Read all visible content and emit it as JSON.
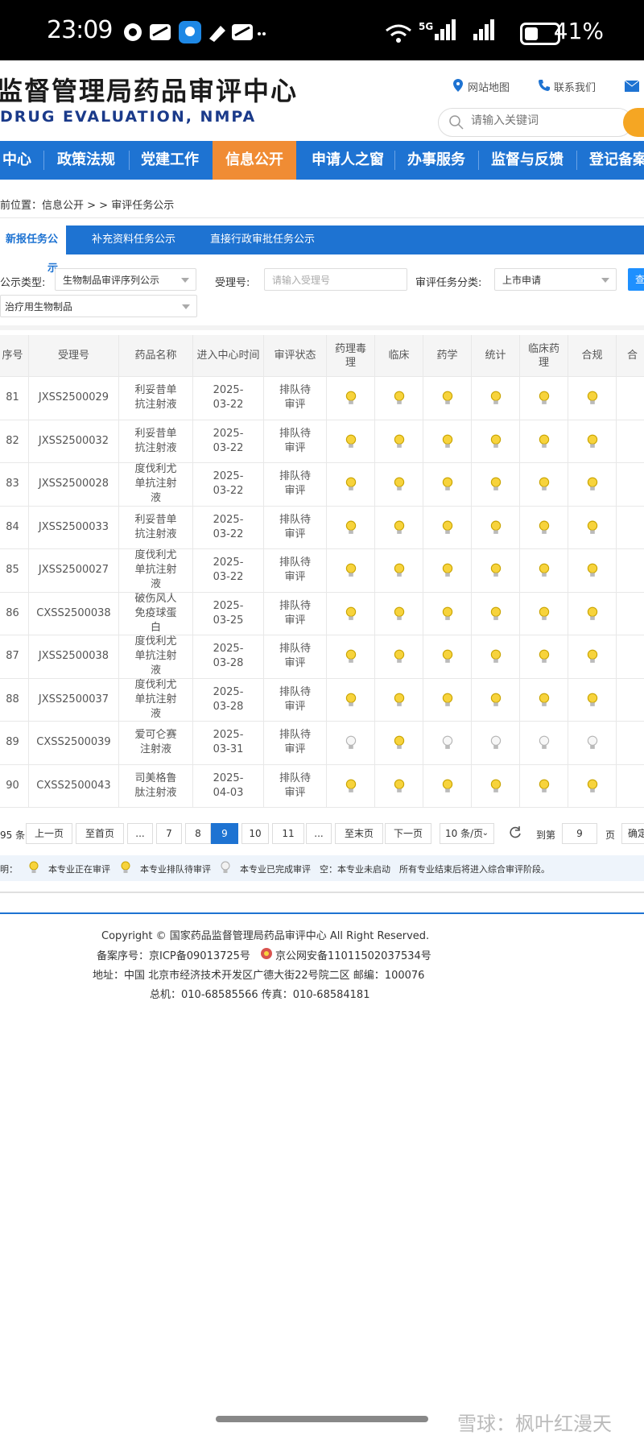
{
  "status_bar": {
    "time": "23:09",
    "network": "5G",
    "battery": "41%",
    "battery_level": 0.41
  },
  "header": {
    "title": "监督管理局药品审评中心",
    "subtitle": "DRUG EVALUATION, NMPA",
    "links": [
      "网站地图",
      "联系我们"
    ],
    "search_placeholder": "请输入关键词"
  },
  "nav": {
    "items": [
      "中心",
      "政策法规",
      "党建工作",
      "信息公开",
      "申请人之窗",
      "办事服务",
      "监督与反馈",
      "登记备案"
    ],
    "active": "信息公开"
  },
  "breadcrumb": {
    "label": "前位置：",
    "path": "信息公开 > > 审评任务公示"
  },
  "tabs": [
    "新报任务公示",
    "补充资料任务公示",
    "直接行政审批任务公示"
  ],
  "filters": {
    "type_label": "公示类型:",
    "type_value": "生物制品审评序列公示",
    "accept_label": "受理号:",
    "accept_placeholder": "请输入受理号",
    "category_label": "审评任务分类:",
    "category_value": "上市申请",
    "sub_value": "治疗用生物制品",
    "query_label": "查"
  },
  "table": {
    "headers": [
      "序号",
      "受理号",
      "药品名称",
      "进入中心时间",
      "审评状态",
      "药理毒理",
      "临床",
      "药学",
      "统计",
      "临床药理",
      "合规",
      "合"
    ],
    "rows": [
      {
        "no": "81",
        "code": "JXSS2500029",
        "name": "利妥昔单抗注射液",
        "date": "2025-03-22",
        "status": "排队待审评",
        "bulbs": [
          "y",
          "y",
          "y",
          "y",
          "y",
          "y"
        ]
      },
      {
        "no": "82",
        "code": "JXSS2500032",
        "name": "利妥昔单抗注射液",
        "date": "2025-03-22",
        "status": "排队待审评",
        "bulbs": [
          "y",
          "y",
          "y",
          "y",
          "y",
          "y"
        ]
      },
      {
        "no": "83",
        "code": "JXSS2500028",
        "name": "度伐利尤单抗注射液",
        "date": "2025-03-22",
        "status": "排队待审评",
        "bulbs": [
          "y",
          "y",
          "y",
          "y",
          "y",
          "y"
        ]
      },
      {
        "no": "84",
        "code": "JXSS2500033",
        "name": "利妥昔单抗注射液",
        "date": "2025-03-22",
        "status": "排队待审评",
        "bulbs": [
          "y",
          "y",
          "y",
          "y",
          "y",
          "y"
        ]
      },
      {
        "no": "85",
        "code": "JXSS2500027",
        "name": "度伐利尤单抗注射液",
        "date": "2025-03-22",
        "status": "排队待审评",
        "bulbs": [
          "y",
          "y",
          "y",
          "y",
          "y",
          "y"
        ]
      },
      {
        "no": "86",
        "code": "CXSS2500038",
        "name": "破伤风人免疫球蛋白",
        "date": "2025-03-25",
        "status": "排队待审评",
        "bulbs": [
          "y",
          "y",
          "y",
          "y",
          "y",
          "y"
        ]
      },
      {
        "no": "87",
        "code": "JXSS2500038",
        "name": "度伐利尤单抗注射液",
        "date": "2025-03-28",
        "status": "排队待审评",
        "bulbs": [
          "y",
          "y",
          "y",
          "y",
          "y",
          "y"
        ]
      },
      {
        "no": "88",
        "code": "JXSS2500037",
        "name": "度伐利尤单抗注射液",
        "date": "2025-03-28",
        "status": "排队待审评",
        "bulbs": [
          "y",
          "y",
          "y",
          "y",
          "y",
          "y"
        ]
      },
      {
        "no": "89",
        "code": "CXSS2500039",
        "name": "爱可仑赛注射液",
        "date": "2025-03-31",
        "status": "排队待审评",
        "bulbs": [
          "w",
          "y",
          "w",
          "w",
          "w",
          "w"
        ]
      },
      {
        "no": "90",
        "code": "CXSS2500043",
        "name": "司美格鲁肽注射液",
        "date": "2025-04-03",
        "status": "排队待审评",
        "bulbs": [
          "y",
          "y",
          "y",
          "y",
          "y",
          "y"
        ]
      }
    ]
  },
  "pagination": {
    "total": "95 条",
    "prev": "上一页",
    "first": "至首页",
    "ellipsis": "...",
    "pages": [
      "7",
      "8",
      "9",
      "10",
      "11"
    ],
    "current": "9",
    "last": "至末页",
    "next": "下一页",
    "page_size": "10 条/页",
    "goto_label": "到第",
    "goto_value": "9",
    "page_unit": "页",
    "confirm": "确定"
  },
  "legend": {
    "label": "明：",
    "reviewing": "本专业正在审评",
    "queued": "本专业排队待审评",
    "done": "本专业已完成审评",
    "empty": "空：本专业未启动",
    "note": "所有专业结束后将进入综合审评阶段。"
  },
  "footer": {
    "copyright": "Copyright © 国家药品监督管理局药品审评中心    All Right Reserved.",
    "icp": "备案序号：京ICP备09013725号",
    "police": "京公网安备11011502037534号",
    "address": "地址：中国 北京市经济技术开发区广德大街22号院二区     邮编：100076",
    "phone": "总机：010-68585566     传真：010-68584181"
  },
  "watermark": "雪球：枫叶红漫天",
  "colors": {
    "primary": "#1e73d2",
    "accent": "#f08c34",
    "bulb_yellow": "#f7d33c",
    "bulb_white": "#e8e8e8"
  }
}
